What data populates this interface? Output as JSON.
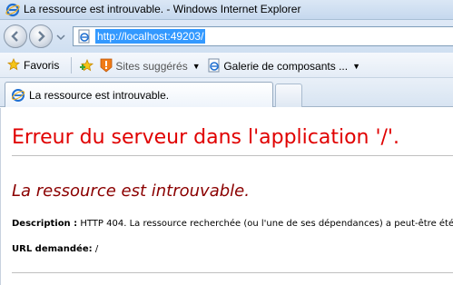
{
  "window": {
    "title": "La ressource est introuvable. - Windows Internet Explorer"
  },
  "address": {
    "url": "http://localhost:49203/"
  },
  "favorites_bar": {
    "favorites_label": "Favoris",
    "suggested_sites_label": "Sites suggérés",
    "gallery_label": "Galerie de composants ..."
  },
  "tab": {
    "label": "La ressource est introuvable."
  },
  "page": {
    "heading": "Erreur du serveur dans l'application '/'.",
    "subheading": "La ressource est introuvable.",
    "description_label": "Description :",
    "description_text": "HTTP 404. La ressource recherchée (ou l'une de ses dépendances) a peut-être été",
    "url_label": "URL demandée:",
    "url_value": "/"
  },
  "colors": {
    "heading": "#e00000",
    "subheading": "#8b0000",
    "url_selection": "#3399ff"
  }
}
